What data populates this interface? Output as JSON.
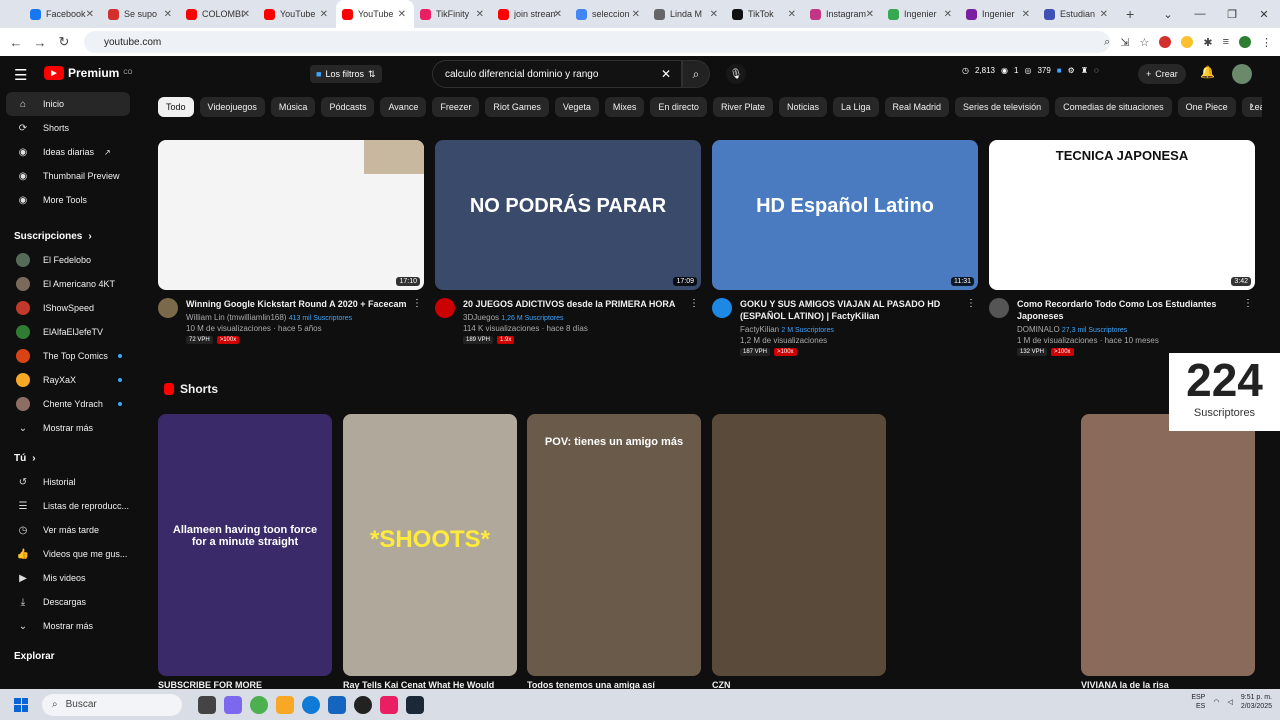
{
  "browser": {
    "tabs": [
      {
        "title": "Facebook",
        "color": "#1877f2"
      },
      {
        "title": "Se supo",
        "color": "#d32f2f"
      },
      {
        "title": "COLOMBIA",
        "color": "#ff0000"
      },
      {
        "title": "YouTube",
        "color": "#ff0000"
      },
      {
        "title": "YouTube",
        "color": "#ff0000"
      },
      {
        "title": "TikFinity",
        "color": "#e91e63"
      },
      {
        "title": "join stream",
        "color": "#ff0000"
      },
      {
        "title": "seleccion",
        "color": "#4285f4"
      },
      {
        "title": "Linda M",
        "color": "#666666"
      },
      {
        "title": "TikTok",
        "color": "#111111"
      },
      {
        "title": "Instagram",
        "color": "#c13584"
      },
      {
        "title": "Ingenier",
        "color": "#34a853"
      },
      {
        "title": "Ingenier",
        "color": "#7b1fa2"
      },
      {
        "title": "Estudian",
        "color": "#3f51b5"
      }
    ],
    "active_tab_index": 4,
    "new_tab": "+",
    "url": "youtube.com"
  },
  "youtube": {
    "logo_text": "Premium",
    "logo_sup": "CO",
    "filters_label": "Los filtros",
    "search_value": "calculo diferencial dominio y rango",
    "stats": {
      "a": "2,813",
      "b": "1",
      "c": "379"
    },
    "create_label": "Crear",
    "sidebar": {
      "main": [
        {
          "label": "Inicio",
          "icon": "home-icon"
        },
        {
          "label": "Shorts",
          "icon": "shorts-icon"
        },
        {
          "label": "Ideas diarias",
          "icon": "ext-icon"
        },
        {
          "label": "Thumbnail Preview",
          "icon": "ext-icon"
        },
        {
          "label": "More Tools",
          "icon": "ext-icon"
        }
      ],
      "subs_header": "Suscripciones",
      "subs": [
        {
          "label": "El Fedelobo",
          "color": "#556b5a"
        },
        {
          "label": "El Americano 4KT",
          "color": "#7a6a5a"
        },
        {
          "label": "IShowSpeed",
          "color": "#c0392b"
        },
        {
          "label": "ElAlfaElJefeTV",
          "color": "#2e7d32"
        },
        {
          "label": "The Top Comics",
          "color": "#d84315"
        },
        {
          "label": "RayXaX",
          "color": "#f9a825"
        },
        {
          "label": "Chente Ydrach",
          "color": "#8d6e63"
        }
      ],
      "show_more": "Mostrar más",
      "you_header": "Tú",
      "you": [
        {
          "label": "Historial"
        },
        {
          "label": "Listas de reproducc..."
        },
        {
          "label": "Ver más tarde"
        },
        {
          "label": "Videos que me gus..."
        },
        {
          "label": "Mis videos"
        },
        {
          "label": "Descargas"
        },
        {
          "label": "Mostrar más"
        }
      ],
      "explore_header": "Explorar"
    },
    "chips": [
      "Todo",
      "Videojuegos",
      "Música",
      "Pódcasts",
      "Avance",
      "Freezer",
      "Riot Games",
      "Vegeta",
      "Mixes",
      "En directo",
      "River Plate",
      "Noticias",
      "La Liga",
      "Real Madrid",
      "Series de televisión",
      "Comedias de situaciones",
      "One Piece",
      "League of Le"
    ],
    "videos": [
      {
        "title": "Winning Google Kickstart Round A 2020 + Facecam",
        "channel": "William Lin (tmwilliamlin168)",
        "subs": "413 mil Suscriptores",
        "views": "10 M de visualizaciones · hace 5 años",
        "duration": "17:10",
        "vph": "72 VPH",
        "badge": ">100x",
        "thumb_color": "#f4f4f4"
      },
      {
        "title": "20 JUEGOS ADICTIVOS desde la PRIMERA HORA",
        "channel": "3DJuegos",
        "subs": "1,26 M Suscriptores",
        "views": "114 K visualizaciones · hace 8 días",
        "duration": "17:09",
        "vph": "189 VPH",
        "badge": "1.9x",
        "thumb_color": "#3a4a6a",
        "thumb_text": "NO PODRÁS PARAR"
      },
      {
        "title": "GOKU Y SUS AMIGOS VIAJAN AL PASADO HD (ESPAÑOL LATINO) | FactyKilian",
        "channel": "FactyKilian",
        "subs": "2 M Suscriptores",
        "views": "1,2 M de visualizaciones",
        "duration": "11:31",
        "vph": "187 VPH",
        "badge": ">100x",
        "thumb_color": "#4a7ac0",
        "thumb_text": "HD Español Latino"
      },
      {
        "title": "Como Recordarlo Todo Como Los Estudiantes Japoneses",
        "channel": "DOMINALO",
        "subs": "27,3 mil Suscriptores",
        "views": "1 M de visualizaciones · hace 10 meses",
        "duration": "3:42",
        "vph": "132 VPH",
        "badge": ">100x",
        "thumb_color": "#ffffff",
        "thumb_text": "TECNICA JAPONESA"
      }
    ],
    "shorts_header": "Shorts",
    "shorts": [
      {
        "title": "SUBSCRIBE FOR MORE",
        "color": "#3a2a6a",
        "overlay": "Allameen having toon force for a minute straight"
      },
      {
        "title": "Ray Tells Kai Cenat What He Would",
        "color": "#b0a89a",
        "overlay": "*SHOOTS*"
      },
      {
        "title": "Todos tenemos una amiga así",
        "color": "#6a5a4a",
        "overlay": "POV: tienes un amigo más"
      },
      {
        "title": "CZN",
        "color": "#5a4a3a",
        "overlay": ""
      },
      {
        "title": "VIVIANA la de la risa",
        "color": "#8a6a5a",
        "overlay": ""
      }
    ],
    "subscriber_badge": {
      "count": "224",
      "label": "Suscriptores"
    }
  },
  "taskbar": {
    "search_label": "Buscar",
    "lang": "ESP",
    "region": "ES",
    "time": "9:51 p. m.",
    "date": "2/03/2025"
  }
}
